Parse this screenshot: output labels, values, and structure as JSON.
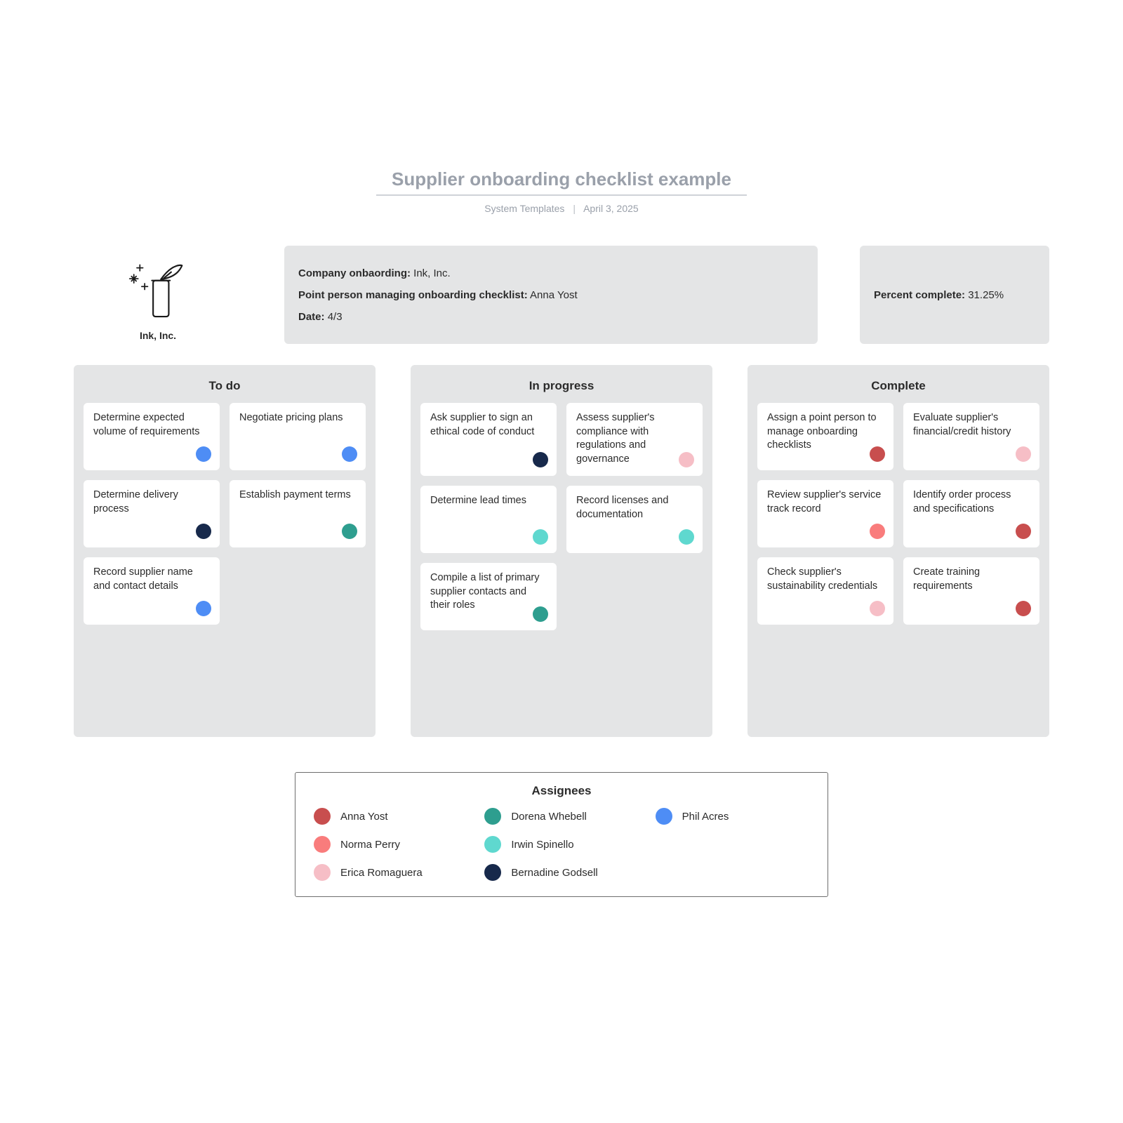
{
  "title": "Supplier onboarding checklist example",
  "subtitle_source": "System Templates",
  "subtitle_date": "April 3, 2025",
  "logo_name": "Ink, Inc.",
  "meta": {
    "company_label": "Company onbaording:",
    "company_value": "Ink, Inc.",
    "point_label": "Point person managing onboarding checklist:",
    "point_value": "Anna Yost",
    "date_label": "Date:",
    "date_value": "4/3"
  },
  "percent": {
    "label": "Percent complete:",
    "value": "31.25%"
  },
  "assignee_colors": {
    "anna": "#C84E4E",
    "norma": "#F97C7C",
    "erica": "#F6BEC6",
    "dorena": "#2E9E8F",
    "irwin": "#5FD8CF",
    "bernadine": "#17294B",
    "phil": "#4E8DF5"
  },
  "columns": [
    {
      "title": "To do",
      "cards": [
        {
          "text": "Determine expected volume of requirements",
          "assignee": "phil"
        },
        {
          "text": "Negotiate pricing plans",
          "assignee": "phil"
        },
        {
          "text": "Determine delivery process",
          "assignee": "bernadine"
        },
        {
          "text": "Establish payment terms",
          "assignee": "dorena"
        },
        {
          "text": "Record supplier name and contact details",
          "assignee": "phil"
        }
      ]
    },
    {
      "title": "In progress",
      "cards": [
        {
          "text": "Ask supplier to sign an ethical code of conduct",
          "assignee": "bernadine"
        },
        {
          "text": "Assess supplier's compliance with regulations and governance",
          "assignee": "erica"
        },
        {
          "text": "Determine lead times",
          "assignee": "irwin"
        },
        {
          "text": "Record licenses and documentation",
          "assignee": "irwin"
        },
        {
          "text": "Compile a list of primary supplier contacts and their roles",
          "assignee": "dorena"
        }
      ]
    },
    {
      "title": "Complete",
      "cards": [
        {
          "text": "Assign a point person to manage onboarding checklists",
          "assignee": "anna"
        },
        {
          "text": "Evaluate supplier's financial/credit history",
          "assignee": "erica"
        },
        {
          "text": "Review supplier's service track record",
          "assignee": "norma"
        },
        {
          "text": "Identify order process and specifications",
          "assignee": "anna"
        },
        {
          "text": "Check supplier's sustainability credentials",
          "assignee": "erica"
        },
        {
          "text": "Create training requirements",
          "assignee": "anna"
        }
      ]
    }
  ],
  "legend": {
    "title": "Assignees",
    "items": [
      {
        "key": "anna",
        "name": "Anna Yost"
      },
      {
        "key": "dorena",
        "name": "Dorena Whebell"
      },
      {
        "key": "phil",
        "name": "Phil Acres"
      },
      {
        "key": "norma",
        "name": "Norma Perry"
      },
      {
        "key": "irwin",
        "name": "Irwin Spinello"
      },
      {
        "key": "_blank1",
        "name": ""
      },
      {
        "key": "erica",
        "name": "Erica Romaguera"
      },
      {
        "key": "bernadine",
        "name": "Bernadine Godsell"
      }
    ]
  }
}
